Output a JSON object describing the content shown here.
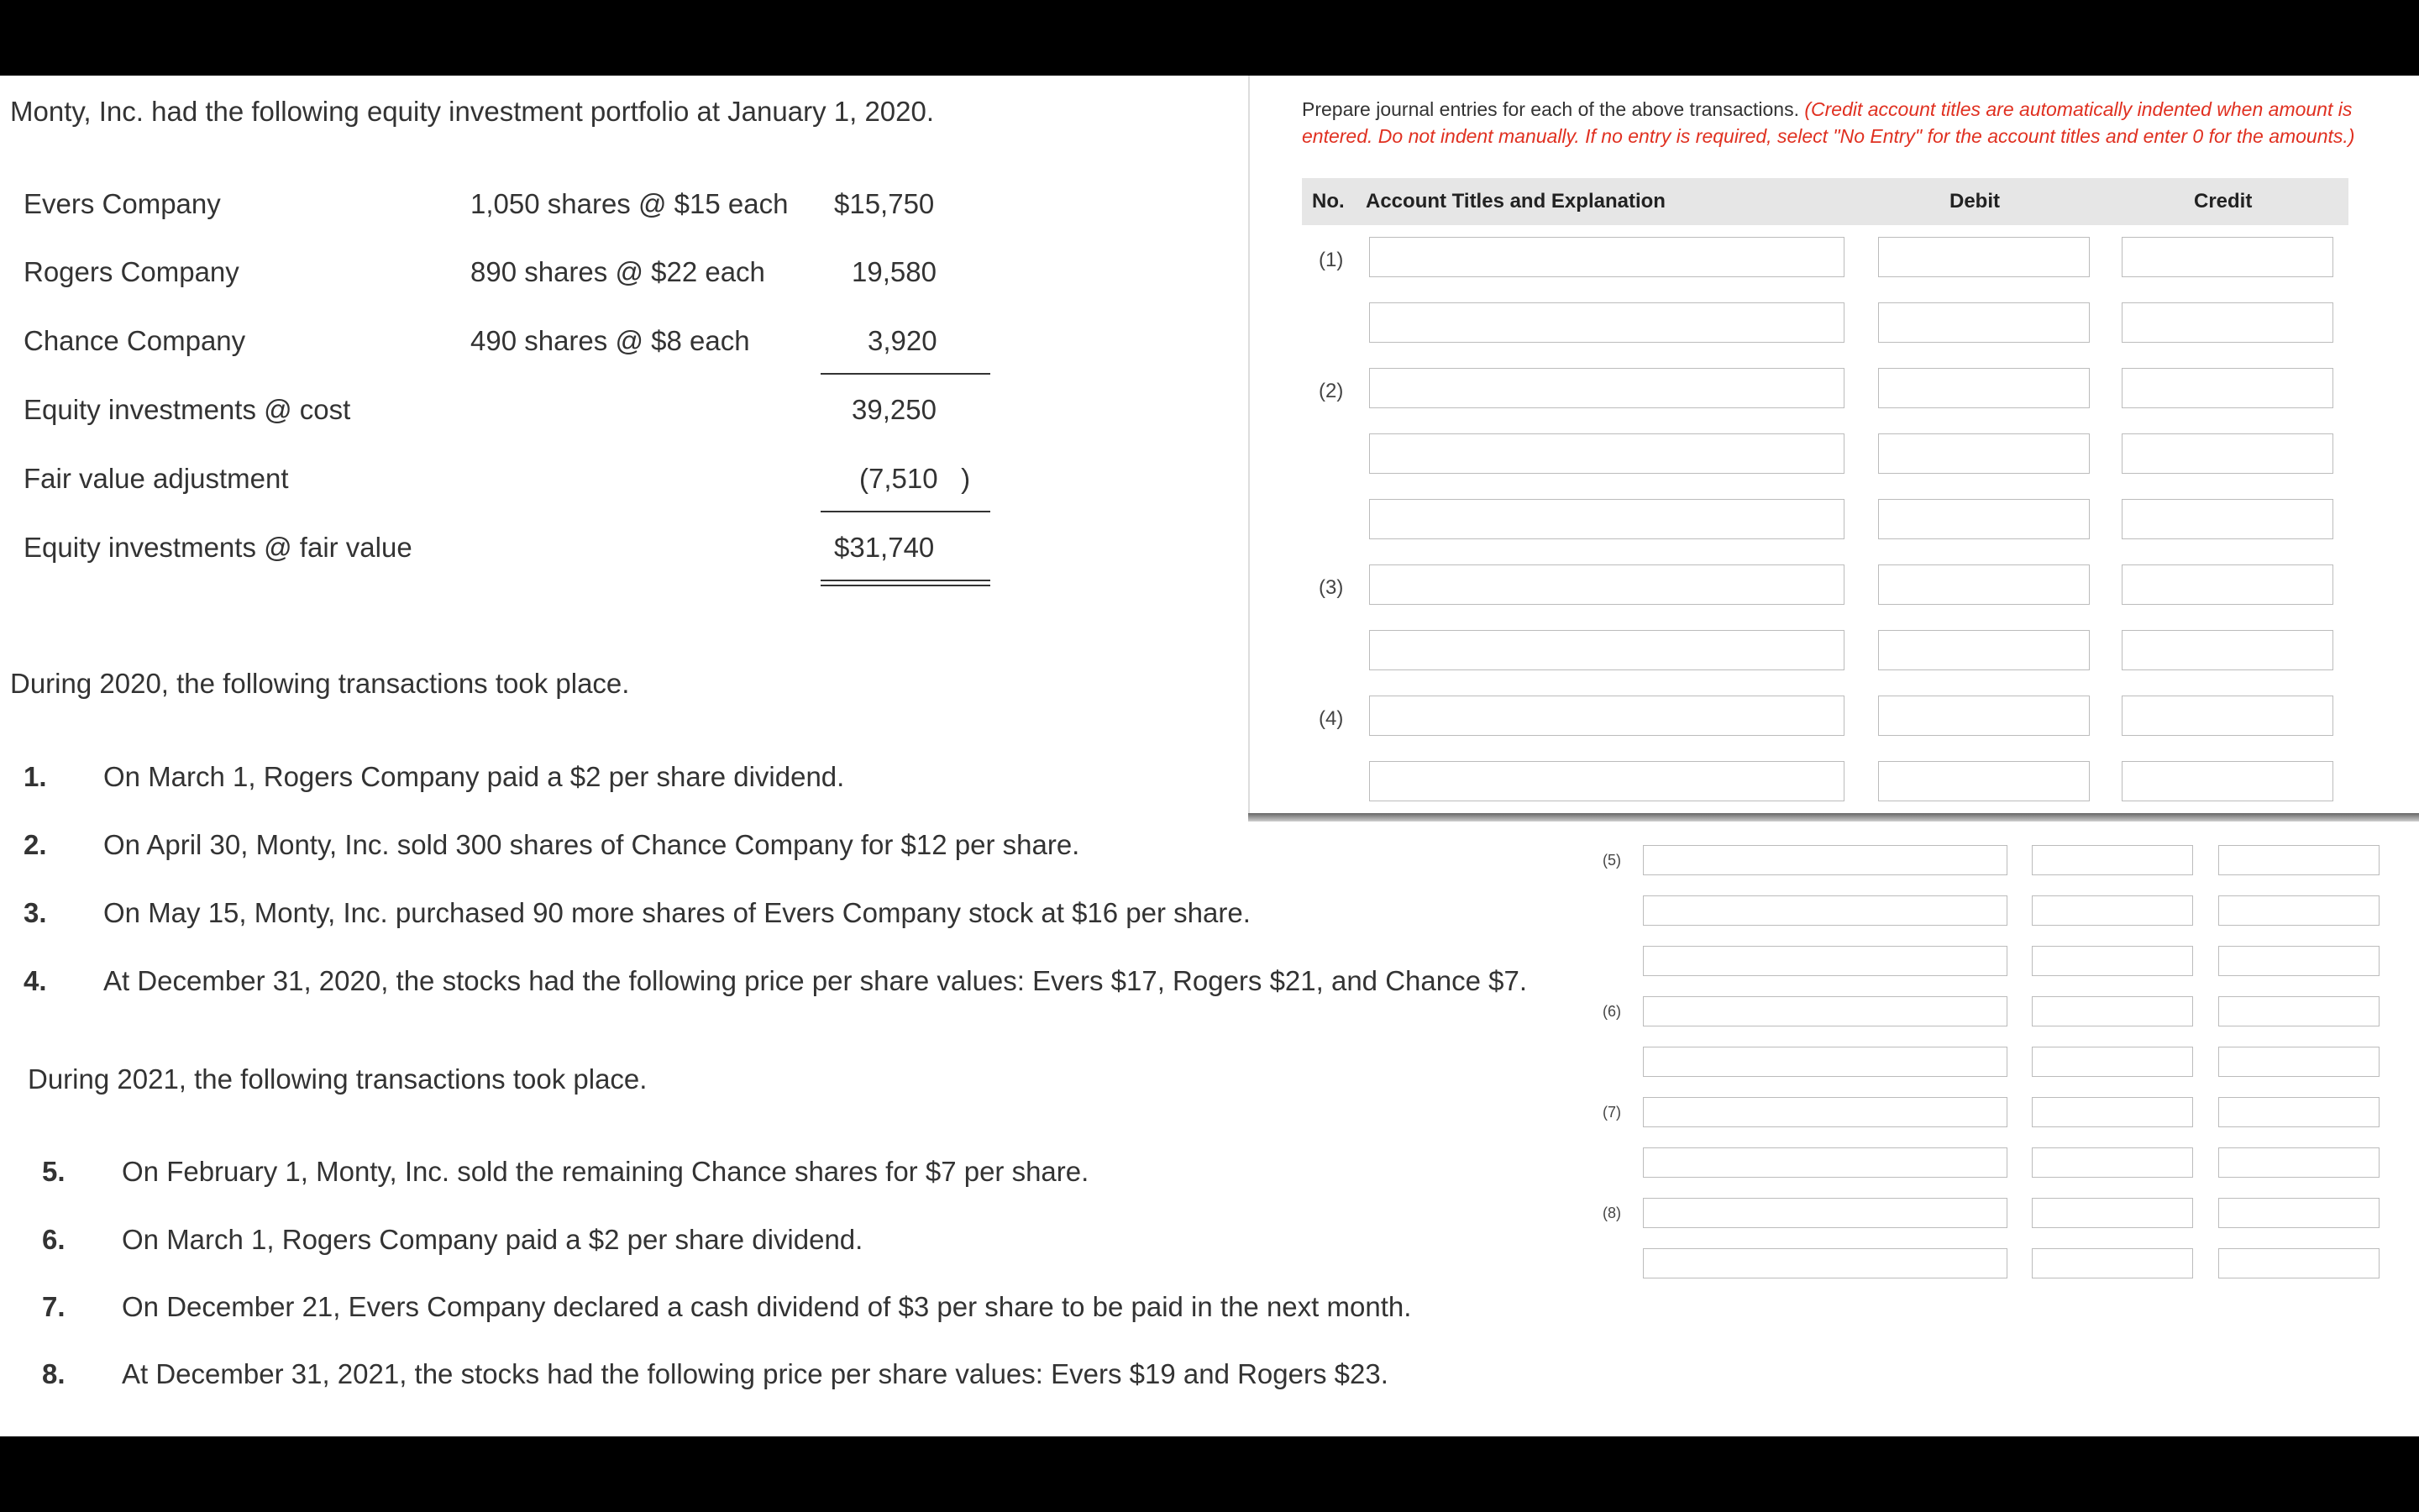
{
  "intro": "Monty, Inc. had the following equity investment portfolio at January 1, 2020.",
  "portfolio": [
    {
      "company": "Evers Company",
      "shares": "1,050 shares @ $15 each",
      "amount": "$15,750"
    },
    {
      "company": "Rogers Company",
      "shares": "890 shares @ $22 each",
      "amount": "19,580"
    },
    {
      "company": "Chance Company",
      "shares": "490 shares @ $8 each",
      "amount": "3,920"
    }
  ],
  "totals": [
    {
      "label": "Equity investments @ cost",
      "amount": "39,250"
    },
    {
      "label": "Fair value adjustment",
      "amount": "(7,510   )"
    },
    {
      "label": "Equity investments @ fair value",
      "amount": "$31,740"
    }
  ],
  "year2020_heading": "During 2020, the following transactions took place.",
  "transactions2020": [
    {
      "num": "1.",
      "text": "On March 1, Rogers Company paid a $2 per share dividend."
    },
    {
      "num": "2.",
      "text": "On April 30, Monty, Inc. sold 300 shares of Chance Company for $12 per share."
    },
    {
      "num": "3.",
      "text": "On May 15, Monty, Inc. purchased 90 more shares of Evers Company stock at $16 per share."
    },
    {
      "num": "4.",
      "text": "At December 31, 2020, the stocks had the following price per share values: Evers $17, Rogers $21, and Chance $7."
    }
  ],
  "year2021_heading": "During 2021, the following transactions took place.",
  "transactions2021": [
    {
      "num": "5.",
      "text": "On February 1, Monty, Inc. sold the remaining Chance shares for $7 per share."
    },
    {
      "num": "6.",
      "text": "On March 1, Rogers Company paid a $2 per share dividend."
    },
    {
      "num": "7.",
      "text": "On December 21, Evers Company declared a cash dividend of $3 per share to be paid in the next month."
    },
    {
      "num": "8.",
      "text": "At December 31, 2021, the stocks had the following price per share values: Evers $19 and Rogers $23."
    }
  ],
  "journal": {
    "instruction": "Prepare journal entries for each of the above transactions.",
    "instruction_red": "(Credit account titles are automatically indented when amount is entered. Do not indent manually. If no entry is required, select \"No Entry\" for the account titles and enter 0 for the amounts.)",
    "headers": {
      "no": "No.",
      "account": "Account Titles and Explanation",
      "debit": "Debit",
      "credit": "Credit"
    },
    "upper_labels": [
      "(1)",
      "(2)",
      "(3)",
      "(4)"
    ],
    "lower_labels": [
      "(5)",
      "(6)",
      "(7)",
      "(8)"
    ],
    "colors": {
      "instruction_red": "#e03020",
      "header_bg": "#e6e6e6"
    }
  }
}
